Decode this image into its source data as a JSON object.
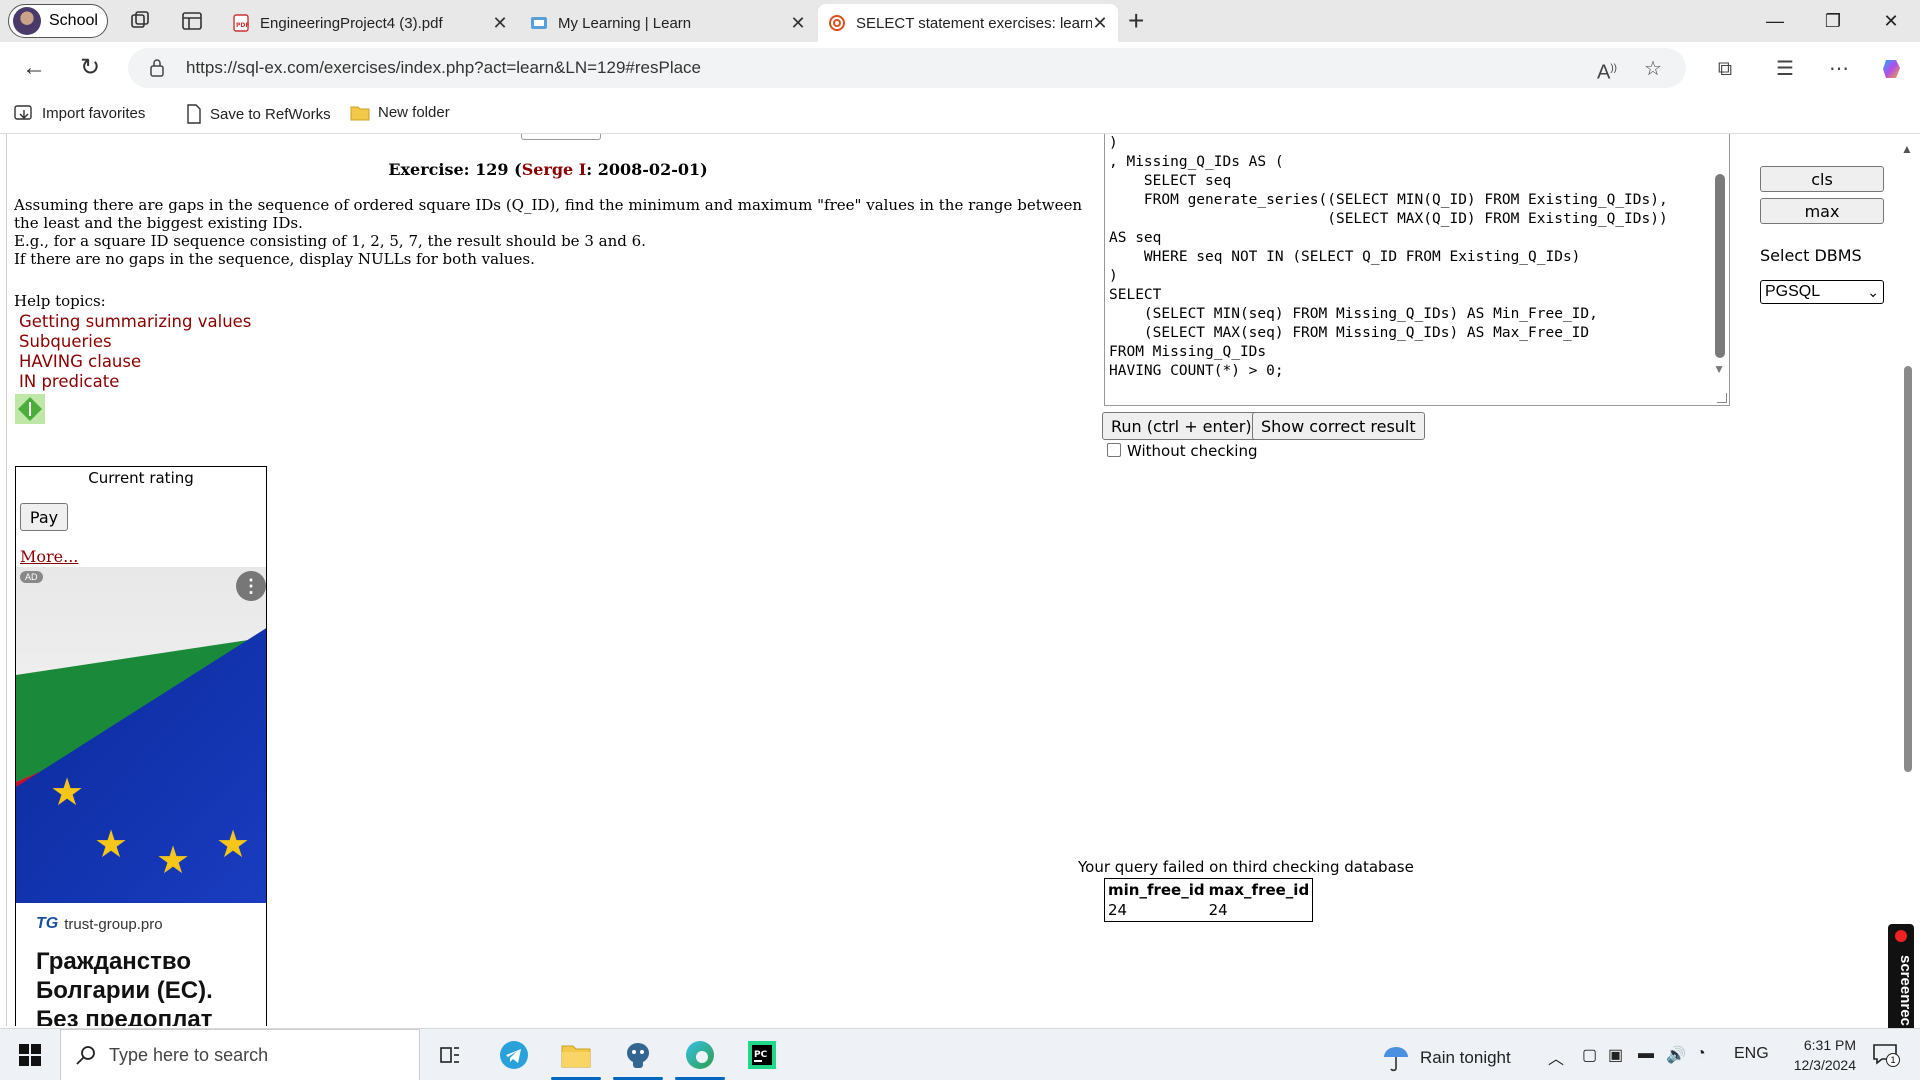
{
  "browser": {
    "profile_label": "School",
    "tabs": [
      {
        "title": "EngineeringProject4 (3).pdf"
      },
      {
        "title": "My Learning | Learn"
      },
      {
        "title": "SELECT statement exercises: learn"
      }
    ],
    "url": "https://sql-ex.com/exercises/index.php?act=learn&LN=129#resPlace",
    "favorites": [
      "Import favorites",
      "Save to RefWorks",
      "New folder"
    ]
  },
  "exercise": {
    "title_prefix": "Exercise: 129 (",
    "author": "Serge I",
    "title_suffix": ": 2008-02-01)",
    "description": [
      "Assuming there are gaps in the sequence of ordered square IDs (Q_ID), find the minimum and maximum \"free\" values in the range between the least and the biggest existing IDs.",
      "E.g., for a square ID sequence consisting of 1, 2, 5, 7, the result should be 3 and 6.",
      "If there are no gaps in the sequence, display NULLs for both values."
    ],
    "help_label": "Help topics:",
    "help_topics": [
      "Getting summarizing values",
      "Subqueries",
      "HAVING clause",
      "IN predicate"
    ]
  },
  "rating": {
    "title": "Current rating",
    "pay_label": "Pay",
    "more_label": "More..."
  },
  "ad": {
    "badge": "AD",
    "site": "trust-group.pro",
    "headline": "Гражданство Болгарии (ЕС). Без предоплат"
  },
  "editor": {
    "code": ")\n, Missing_Q_IDs AS (\n    SELECT seq\n    FROM generate_series((SELECT MIN(Q_ID) FROM Existing_Q_IDs),\n                         (SELECT MAX(Q_ID) FROM Existing_Q_IDs))\nAS seq\n    WHERE seq NOT IN (SELECT Q_ID FROM Existing_Q_IDs)\n)\nSELECT\n    (SELECT MIN(seq) FROM Missing_Q_IDs) AS Min_Free_ID,\n    (SELECT MAX(seq) FROM Missing_Q_IDs) AS Max_Free_ID\nFROM Missing_Q_IDs\nHAVING COUNT(*) > 0;"
  },
  "controls": {
    "run_label": "Run (ctrl + enter)",
    "show_label": "Show correct result",
    "without_checking": "Without checking",
    "cls_label": "cls",
    "max_label": "max",
    "dbms_label": "Select DBMS",
    "dbms_value": "PGSQL"
  },
  "result": {
    "message": "Your query failed on third checking database",
    "columns": [
      "min_free_id",
      "max_free_id"
    ],
    "rows": [
      [
        "24",
        "24"
      ]
    ]
  },
  "taskbar": {
    "search_placeholder": "Type here to search",
    "weather": "Rain tonight",
    "lang": "ENG",
    "time": "6:31 PM",
    "date": "12/3/2024",
    "notification_count": "1"
  },
  "screenrec": "screenrec",
  "colors": {
    "link": "#8b0000",
    "accent": "#0067c0"
  }
}
